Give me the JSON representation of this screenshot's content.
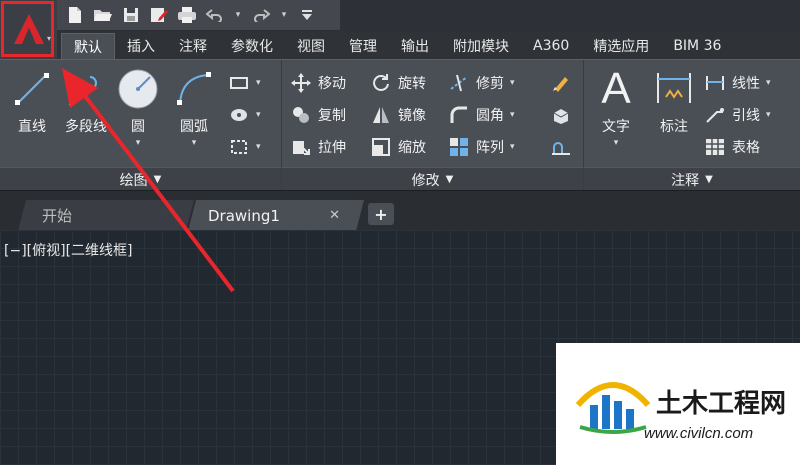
{
  "quick_access": {
    "icons": [
      "new-icon",
      "open-icon",
      "save-icon",
      "save-as-icon",
      "print-icon",
      "undo-icon",
      "redo-icon",
      "customize-icon"
    ]
  },
  "tabs": [
    {
      "label": "默认",
      "active": true
    },
    {
      "label": "插入"
    },
    {
      "label": "注释"
    },
    {
      "label": "参数化"
    },
    {
      "label": "视图"
    },
    {
      "label": "管理"
    },
    {
      "label": "输出"
    },
    {
      "label": "附加模块"
    },
    {
      "label": "A360"
    },
    {
      "label": "精选应用"
    },
    {
      "label": "BIM 36"
    }
  ],
  "ribbon": {
    "draw": {
      "title": "绘图",
      "tools": [
        "直线",
        "多段线",
        "圆",
        "圆弧"
      ]
    },
    "modify": {
      "title": "修改",
      "tools": [
        "移动",
        "旋转",
        "修剪",
        "复制",
        "镜像",
        "圆角",
        "拉伸",
        "缩放",
        "阵列"
      ]
    },
    "annotation": {
      "title": "注释",
      "tools": [
        "文字",
        "标注",
        "线性",
        "引线",
        "表格"
      ]
    }
  },
  "file_tabs": {
    "start": "开始",
    "drawing": "Drawing1",
    "close_symbol": "✕",
    "new_symbol": "+"
  },
  "viewport_label": "[−][俯视][二维线框]",
  "watermark": {
    "title": "土木工程网",
    "url": "www.civilcn.com"
  },
  "colors": {
    "highlight": "#e8262c",
    "ribbon": "#4a4f56",
    "canvas": "#212830"
  }
}
